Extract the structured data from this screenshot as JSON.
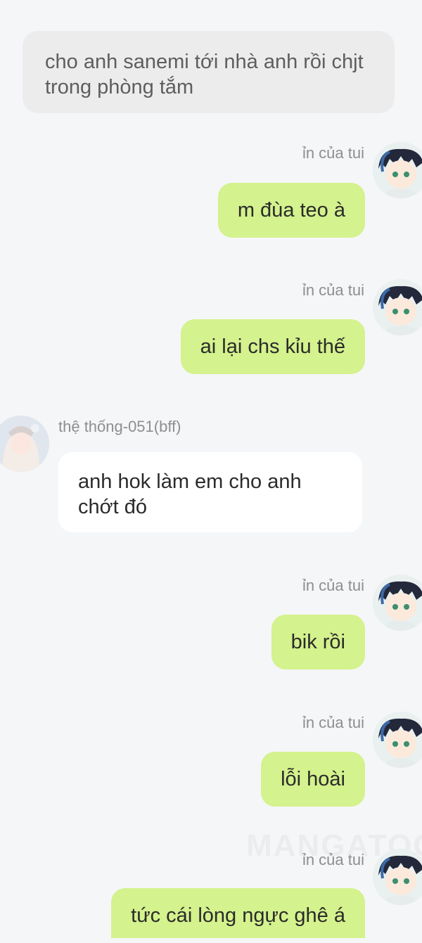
{
  "narration": "cho anh sanemi tới nhà anh rồi chjt trong phòng tắm",
  "me_name": "ỉn của tui",
  "other_name": "thệ thống-051(bff)",
  "messages": [
    {
      "from": "me",
      "text": "m đùa teo à"
    },
    {
      "from": "me",
      "text": "ai lại chs kỉu thế"
    },
    {
      "from": "other",
      "text": "anh hok làm em cho anh chớt đó"
    },
    {
      "from": "me",
      "text": "bik rồi"
    },
    {
      "from": "me",
      "text": "lỗi hoài"
    },
    {
      "from": "me",
      "text": "tức cái lòng ngực ghê á"
    }
  ],
  "watermark": "MANGATOON",
  "colors": {
    "background": "#f5f6f8",
    "me_bubble": "#d4f28d",
    "other_bubble": "#ffffff",
    "narration_bg": "#ececed"
  }
}
